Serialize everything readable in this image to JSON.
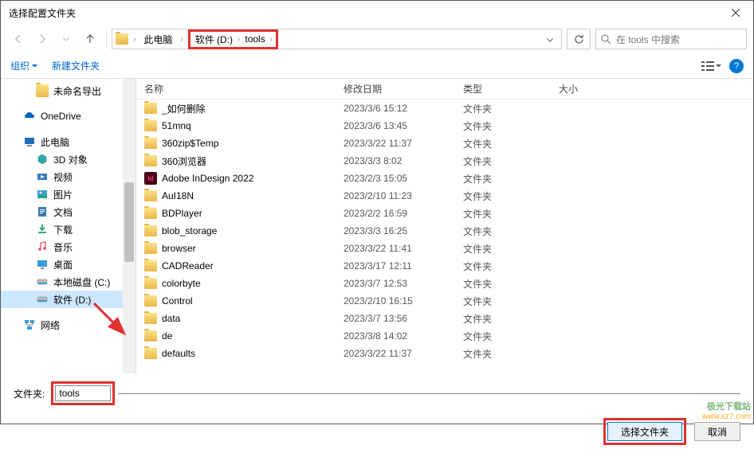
{
  "title": "选择配置文件夹",
  "breadcrumb": {
    "root": "此电脑",
    "drive": "软件 (D:)",
    "folder": "tools"
  },
  "search": {
    "placeholder": "在 tools 中搜索"
  },
  "toolbar": {
    "organize": "组织",
    "new_folder": "新建文件夹"
  },
  "columns": {
    "name": "名称",
    "date": "修改日期",
    "type": "类型",
    "size": "大小"
  },
  "tree": [
    {
      "label": "未命名导出",
      "icon": "folder",
      "level": 2
    },
    {
      "label": "OneDrive",
      "icon": "onedrive",
      "level": 1,
      "gap": true
    },
    {
      "label": "此电脑",
      "icon": "pc",
      "level": 1,
      "gap": true
    },
    {
      "label": "3D 对象",
      "icon": "3d",
      "level": 2
    },
    {
      "label": "视频",
      "icon": "video",
      "level": 2
    },
    {
      "label": "图片",
      "icon": "pictures",
      "level": 2
    },
    {
      "label": "文档",
      "icon": "docs",
      "level": 2
    },
    {
      "label": "下载",
      "icon": "downloads",
      "level": 2
    },
    {
      "label": "音乐",
      "icon": "music",
      "level": 2
    },
    {
      "label": "桌面",
      "icon": "desktop",
      "level": 2
    },
    {
      "label": "本地磁盘 (C:)",
      "icon": "disk",
      "level": 2
    },
    {
      "label": "软件 (D:)",
      "icon": "disk",
      "level": 2,
      "selected": true
    },
    {
      "label": "网络",
      "icon": "network",
      "level": 1,
      "gap": true
    }
  ],
  "files": [
    {
      "name": "_如何删除",
      "date": "2023/3/6 15:12",
      "type": "文件夹",
      "icon": "folder"
    },
    {
      "name": "51mnq",
      "date": "2023/3/6 13:45",
      "type": "文件夹",
      "icon": "folder"
    },
    {
      "name": "360zip$Temp",
      "date": "2023/3/22 11:37",
      "type": "文件夹",
      "icon": "folder"
    },
    {
      "name": "360浏览器",
      "date": "2023/3/3 8:02",
      "type": "文件夹",
      "icon": "folder"
    },
    {
      "name": "Adobe InDesign 2022",
      "date": "2023/2/3 15:05",
      "type": "文件夹",
      "icon": "indesign"
    },
    {
      "name": "AuI18N",
      "date": "2023/2/10 11:23",
      "type": "文件夹",
      "icon": "folder"
    },
    {
      "name": "BDPlayer",
      "date": "2023/2/2 16:59",
      "type": "文件夹",
      "icon": "folder"
    },
    {
      "name": "blob_storage",
      "date": "2023/3/3 16:25",
      "type": "文件夹",
      "icon": "folder"
    },
    {
      "name": "browser",
      "date": "2023/3/22 11:41",
      "type": "文件夹",
      "icon": "folder"
    },
    {
      "name": "CADReader",
      "date": "2023/3/17 12:11",
      "type": "文件夹",
      "icon": "folder"
    },
    {
      "name": "colorbyte",
      "date": "2023/3/7 12:53",
      "type": "文件夹",
      "icon": "folder"
    },
    {
      "name": "Control",
      "date": "2023/2/10 16:15",
      "type": "文件夹",
      "icon": "folder"
    },
    {
      "name": "data",
      "date": "2023/3/7 13:56",
      "type": "文件夹",
      "icon": "folder"
    },
    {
      "name": "de",
      "date": "2023/3/8 14:02",
      "type": "文件夹",
      "icon": "folder"
    },
    {
      "name": "defaults",
      "date": "2023/3/22 11:37",
      "type": "文件夹",
      "icon": "folder"
    }
  ],
  "footer": {
    "folder_label": "文件夹:",
    "folder_value": "tools",
    "select": "选择文件夹",
    "cancel": "取消"
  },
  "watermark": {
    "cn": "极光下载站",
    "url": "www.xz7.com"
  }
}
